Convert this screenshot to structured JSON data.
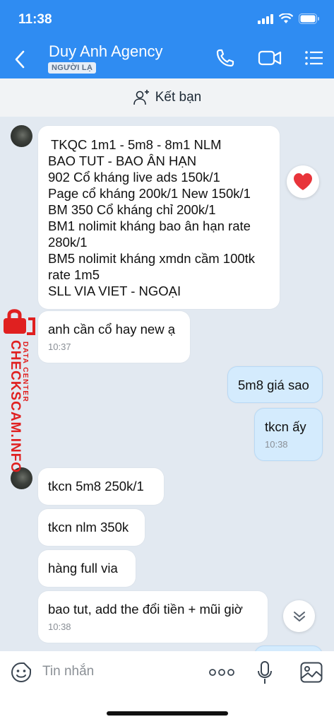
{
  "status": {
    "time": "11:38"
  },
  "header": {
    "name": "Duy Anh Agency",
    "tag": "NGƯỜI LẠ"
  },
  "friend_bar": {
    "label": "Kết bạn"
  },
  "messages": {
    "m1": {
      "lines": [
        "TKQC 1m1 - 5m8 - 8m1 NLM",
        "BAO TUT - BAO ÂN HẠN",
        "902 Cổ kháng live ads 150k/1",
        "Page cổ kháng 200k/1 New 150k/1",
        "BM 350 Cổ kháng chỉ 200k/1",
        "BM1 nolimit kháng bao ân hạn rate",
        "280k/1",
        "BM5 nolimit kháng xmdn cầm 100tk",
        "rate 1m5",
        "SLL VIA VIET - NGOẠI"
      ]
    },
    "m2": {
      "text": "anh cần cổ hay new ạ",
      "time": "10:37"
    },
    "m3": {
      "text": "5m8 giá sao"
    },
    "m4": {
      "text": "tkcn ấy",
      "time": "10:38"
    },
    "m5": {
      "text": "tkcn 5m8 250k/1"
    },
    "m6": {
      "text": "tkcn nlm 350k"
    },
    "m7": {
      "text": "hàng full via"
    },
    "m8": {
      "text": "bao tut, add the đổi tiền + mũi giờ",
      "time": "10:38"
    }
  },
  "watermark": {
    "main": "CHECKSCAM.INFO",
    "sub": "DATA CENTER"
  },
  "composer": {
    "placeholder": "Tin nhắn"
  },
  "colors": {
    "header": "#2f8cf2",
    "my_bubble": "#d4ebfd",
    "background": "#e2e9f1",
    "watermark": "#e02020"
  }
}
